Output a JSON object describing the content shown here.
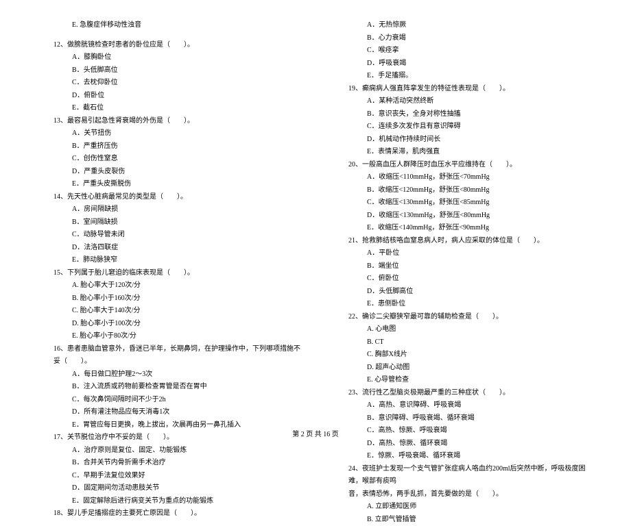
{
  "left_col": {
    "orphan_option": "E. 急腹症伴移动性浊音",
    "questions": [
      {
        "num": "12、",
        "stem": "做膀胱镜检查时患者的卧位应是（　　）。",
        "opts": [
          "A．膝胸卧位",
          "B．头低脚高位",
          "C．去枕仰卧位",
          "D．俯卧位",
          "E．截石位"
        ]
      },
      {
        "num": "13、",
        "stem": "最容易引起急性肾衰竭的外伤是（　　）。",
        "opts": [
          "A．关节扭伤",
          "B．严重挤压伤",
          "C．创伤性窒息",
          "D．严重头皮裂伤",
          "E．严重头皮撕脱伤"
        ]
      },
      {
        "num": "14、",
        "stem": "先天性心脏病最常见的类型是（　　）。",
        "opts": [
          "A．房间隔缺损",
          "B．室间隔缺损",
          "C．动脉导管未闭",
          "D．法洛四联症",
          "E．肺动脉狭窄"
        ]
      },
      {
        "num": "15、",
        "stem": "下列属于胎儿窘迫的临床表现是（　　）。",
        "opts": [
          "A. 胎心率大于120次/分",
          "B. 胎心率小于160次/分",
          "C. 胎心率大于140次/分",
          "D. 胎心率小于100次/分",
          "E. 胎心率小于80次/分"
        ]
      },
      {
        "num": "16、",
        "stem": "患者患脑血管意外，昏迷已半年，长期鼻饲，在护理操作中，下列哪项措施不妥（　　）。",
        "opts": [
          "A．每日做口腔护理2～3次",
          "B．注入流质或药物前要检查胃管是否在胃中",
          "C．每次鼻饲间隔时间不少于2h",
          "D．所有灌注物品应每天消毒1次",
          "E．胃管应每日更换，晚上拔出，次晨再由另一鼻孔插入"
        ]
      },
      {
        "num": "17、",
        "stem": "关节脱位治疗中不妥的是（　　）。",
        "opts": [
          "A．治疗原则是复位、固定、功能锻炼",
          "B．合并关节内骨折需手术治疗",
          "C．早期手法复位效果好",
          "D．固定期间勿活动患肢关节",
          "E．固定解除后进行病变关节为重点的功能锻炼"
        ]
      },
      {
        "num": "18、",
        "stem": "婴儿手足搐搦症的主要死亡原因是（　　）。",
        "opts": []
      }
    ]
  },
  "right_col": {
    "orphan_opts": [
      "A．无热惊厥",
      "B．心力衰竭",
      "C．喉痉挛",
      "D．呼吸衰竭",
      "E．手足搐搦。"
    ],
    "questions": [
      {
        "num": "19、",
        "stem": "癫痫病人强直阵挛发生的特征性表现是（　　）。",
        "opts": [
          "A．某种活动突然终断",
          "B．意识丧失，全身对称性抽搐",
          "C．连续多次发作且有意识障碍",
          "D．机械动作持续时间长",
          "E．表情呆滞，肌肉强直"
        ]
      },
      {
        "num": "20、",
        "stem": "一般高血压人群降压时血压水平应维持在（　　）。",
        "opts": [
          "A．收缩压<110mmHg，舒张压<70mmHg",
          "B．收缩压<120mmHg，舒张压<80mmHg",
          "C．收缩压<130mmHg，舒张压<85mmHg",
          "D．收缩压<130mmHg，舒张压<80mmHg",
          "E．收缩压<140mmHg，舒张压<90mmHg"
        ]
      },
      {
        "num": "21、",
        "stem": "抢救肺结核咯血窒息病人时，病人应采取的体位是（　　）。",
        "opts": [
          "A．平卧位",
          "B．端坐位",
          "C．俯卧位",
          "D．头低脚高位",
          "E．患侧卧位"
        ]
      },
      {
        "num": "22、",
        "stem": "确诊二尖瓣狭窄最可靠的辅助检查是（　　）。",
        "opts": [
          "A. 心电图",
          "B. CT",
          "C. 胸部X线片",
          "D. 超声心动图",
          "E. 心导管检查"
        ]
      },
      {
        "num": "23、",
        "stem": "流行性乙型脑炎极期最严重的三种症状（　　）。",
        "opts": [
          "A．高热、意识障碍、呼吸衰竭",
          "B．意识障碍、呼吸衰竭、循环衰竭",
          "C．高热、惊厥、呼吸衰竭",
          "D．高热、惊厥、循环衰竭",
          "E．惊厥、呼吸衰竭、循环衰竭"
        ]
      },
      {
        "num": "24、",
        "stem": "夜班护士发现一个支气管扩张症病人咯血约200ml后突然中断，呼吸极度困难，喉部有痰鸣",
        "stem_cont": "音，表情恐怖，两手乱抓，首先要做的是（　　）。",
        "opts": [
          "A. 立即通知医师",
          "B. 立即气管插管"
        ]
      }
    ]
  },
  "footer": "第 2 页 共 16 页"
}
